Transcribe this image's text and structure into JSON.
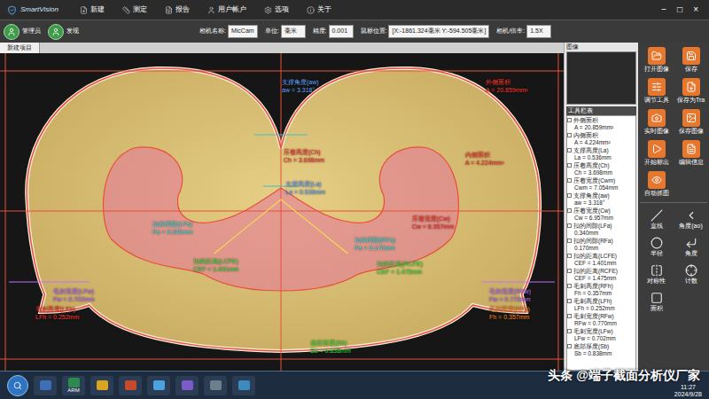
{
  "window": {
    "title": "SmartVision",
    "controls": [
      "−",
      "□",
      "×"
    ]
  },
  "menu": [
    {
      "label": "新建"
    },
    {
      "label": "测定"
    },
    {
      "label": "报告"
    },
    {
      "label": "用户帐户"
    },
    {
      "label": "选项"
    },
    {
      "label": "关于"
    }
  ],
  "toolbar": {
    "buttons": [
      {
        "label": "管理员"
      },
      {
        "label": "发现"
      }
    ],
    "fields": [
      {
        "label": "相机名称:",
        "value": "MicCam"
      },
      {
        "label": "单位:",
        "value": "毫米"
      },
      {
        "label": "精度:",
        "value": "0.001"
      },
      {
        "label": "鼠标位置:",
        "value": "[X:-1861.324毫米 Y:-594.505毫米]"
      },
      {
        "label": "相机/倍率:",
        "value": "1.5X"
      }
    ]
  },
  "tabs": [
    {
      "label": "新建项目",
      "selected": true
    }
  ],
  "canvas": {
    "annotations": [
      {
        "name": "支撑角度(aw)",
        "value": "aw = 3.318°",
        "color": "#6aa8ff"
      },
      {
        "name": "外侧面积",
        "value": "A = 20.859mm²",
        "color": "#ff3b30"
      },
      {
        "name": "内侧面积",
        "value": "A = 4.224mm²",
        "color": "#ff3b30"
      },
      {
        "name": "压着高度(Ch)",
        "value": "Ch = 3.698mm",
        "color": "#ff3b30"
      },
      {
        "name": "支撑高度(La)",
        "value": "La = 0.536mm",
        "color": "#6aa8ff"
      },
      {
        "name": "压着宽度(Cw)",
        "value": "Cw = 6.957mm",
        "color": "#ff3b30"
      },
      {
        "name": "扣的间隙(LFa)",
        "value": "Fa = 0.340mm",
        "color": "#40e0e0"
      },
      {
        "name": "扣的距离(LCFE)",
        "value": "CEF = 1.401mm",
        "color": "#40e040"
      },
      {
        "name": "扣的间隙(RFa)",
        "value": "Fa = 0.170mm",
        "color": "#40e0e0"
      },
      {
        "name": "扣的距离(RCFE)",
        "value": "CEF = 1.475mm",
        "color": "#40e040"
      },
      {
        "name": "毛刺宽度(LFw)",
        "value": "Fw = 0.702mm",
        "color": "#c070ff"
      },
      {
        "name": "毛刺高度(LFh)",
        "value": "LFh = 0.252mm",
        "color": "#ff3b30"
      },
      {
        "name": "毛刺宽度(RFw)",
        "value": "Fw = 0.770mm",
        "color": "#c070ff"
      },
      {
        "name": "毛刺高度(RFh)",
        "value": "Fh = 0.357mm",
        "color": "#ff8a20"
      },
      {
        "name": "底部厚度(Sb)",
        "value": "Sb = 0.838mm",
        "color": "#40e040"
      }
    ]
  },
  "preview": {
    "title": "图像"
  },
  "tool_list": {
    "title": "工具栏表",
    "items": [
      {
        "name": "外侧面积",
        "value": "A = 20.859mm²",
        "checked": false
      },
      {
        "name": "内侧面积",
        "value": "A = 4.224mm²",
        "checked": false
      },
      {
        "name": "支撑高度(La)",
        "value": "La = 0.536mm",
        "checked": false
      },
      {
        "name": "压着高度(Ch)",
        "value": "Ch = 3.698mm",
        "checked": false
      },
      {
        "name": "压着宽度(Cwm)",
        "value": "Cwm = 7.054mm",
        "checked": false
      },
      {
        "name": "支撑角度(aw)",
        "value": "aw = 3.318°",
        "checked": false
      },
      {
        "name": "压着宽度(Cw)",
        "value": "Cw = 6.957mm",
        "checked": false
      },
      {
        "name": "扣的间隙(LFa)",
        "value": "0.340mm",
        "checked": false
      },
      {
        "name": "扣的间隙(RFa)",
        "value": "0.170mm",
        "checked": false
      },
      {
        "name": "扣的距离(LCFE)",
        "value": "CEF = 1.401mm",
        "checked": false
      },
      {
        "name": "扣的距离(RCFE)",
        "value": "CEF = 1.475mm",
        "checked": false
      },
      {
        "name": "毛刺高度(RFh)",
        "value": "Fh = 0.357mm",
        "checked": false
      },
      {
        "name": "毛刺高度(LFh)",
        "value": "LFh = 0.252mm",
        "checked": false
      },
      {
        "name": "毛刺宽度(RFw)",
        "value": "RFw = 0.770mm",
        "checked": false
      },
      {
        "name": "毛刺宽度(LFw)",
        "value": "LFw = 0.702mm",
        "checked": false
      },
      {
        "name": "底部厚度(Sb)",
        "value": "Sb = 0.838mm",
        "checked": false
      }
    ]
  },
  "actions": [
    {
      "label": "打开图像"
    },
    {
      "label": "保存"
    },
    {
      "label": "调节工具"
    },
    {
      "label": "保存为Tra"
    },
    {
      "label": "实时图像"
    },
    {
      "label": "保存图像"
    },
    {
      "label": "开始标出"
    },
    {
      "label": "编辑信息"
    },
    {
      "label": "自动抓图"
    }
  ],
  "tools": [
    {
      "label": "直线"
    },
    {
      "label": "角度(ao)"
    },
    {
      "label": "半径"
    },
    {
      "label": "角度"
    },
    {
      "label": "对称性"
    },
    {
      "label": "计数"
    },
    {
      "label": "面积"
    }
  ],
  "taskbar": {
    "badge": "ARM",
    "time": "11:27",
    "date": "2024/9/28"
  },
  "watermark": "头条 @端子截面分析仪厂家"
}
